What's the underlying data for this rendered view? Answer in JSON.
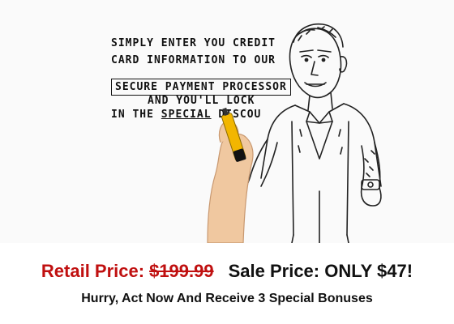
{
  "whiteboard": {
    "line1": "SIMPLY ENTER YOU CREDIT",
    "line2": "CARD INFORMATION TO OUR",
    "line3": "SECURE PAYMENT PROCESSOR",
    "line4": "AND YOU'LL LOCK",
    "line5_prefix": "IN THE ",
    "line5_underlined": "SPECIAL",
    "line5_suffix": " DISCOU"
  },
  "pricing": {
    "retail_label": "Retail Price:",
    "retail_amount": "$199.99",
    "sale_text": "Sale Price: ONLY $47!",
    "promo_text": "Hurry, Act Now And Receive 3 Special Bonuses"
  },
  "colors": {
    "retail": "#c01010",
    "text": "#111111",
    "background": "#ffffff"
  },
  "icons": {
    "illustration": "man-sketch-illustration",
    "hand": "drawing-hand-icon"
  }
}
